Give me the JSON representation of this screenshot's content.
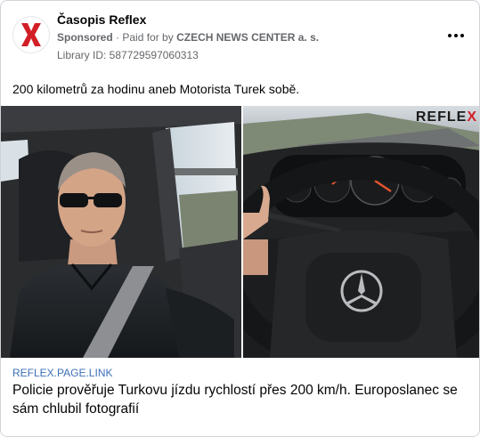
{
  "header": {
    "page_name": "Časopis Reflex",
    "sponsored": "Sponsored",
    "separator": "·",
    "paid_for_by": "Paid for by",
    "company": "CZECH NEWS CENTER a. s.",
    "library_id": "Library ID: 587729597060313",
    "more_icon": "more-horizontal-icon"
  },
  "post": {
    "text": "200 kilometrů za hodinu aneb Motorista Turek sobě."
  },
  "media": {
    "watermark_left": "REFLE",
    "watermark_right": "X"
  },
  "link": {
    "domain": "REFLEX.PAGE.LINK",
    "title": "Policie prověřuje Turkovu jízdu rychlostí přes 200 km/h. Europoslanec se sám chlubil fotografií"
  },
  "colors": {
    "brand_red": "#d21f26",
    "link_blue": "#3b6fb6",
    "muted_text": "#65676b"
  }
}
